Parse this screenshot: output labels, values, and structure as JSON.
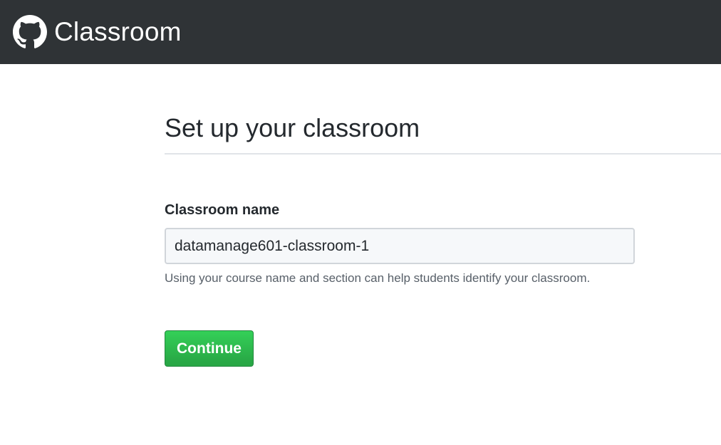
{
  "header": {
    "brand": "Classroom",
    "logo_icon": "github-octocat-icon",
    "background": "#2f3336"
  },
  "main": {
    "title": "Set up your classroom",
    "form": {
      "label": "Classroom name",
      "input_value": "datamanage601-classroom-1",
      "hint": "Using your course name and section can help students identify your classroom.",
      "submit_label": "Continue",
      "submit_color": "#28a745"
    }
  }
}
